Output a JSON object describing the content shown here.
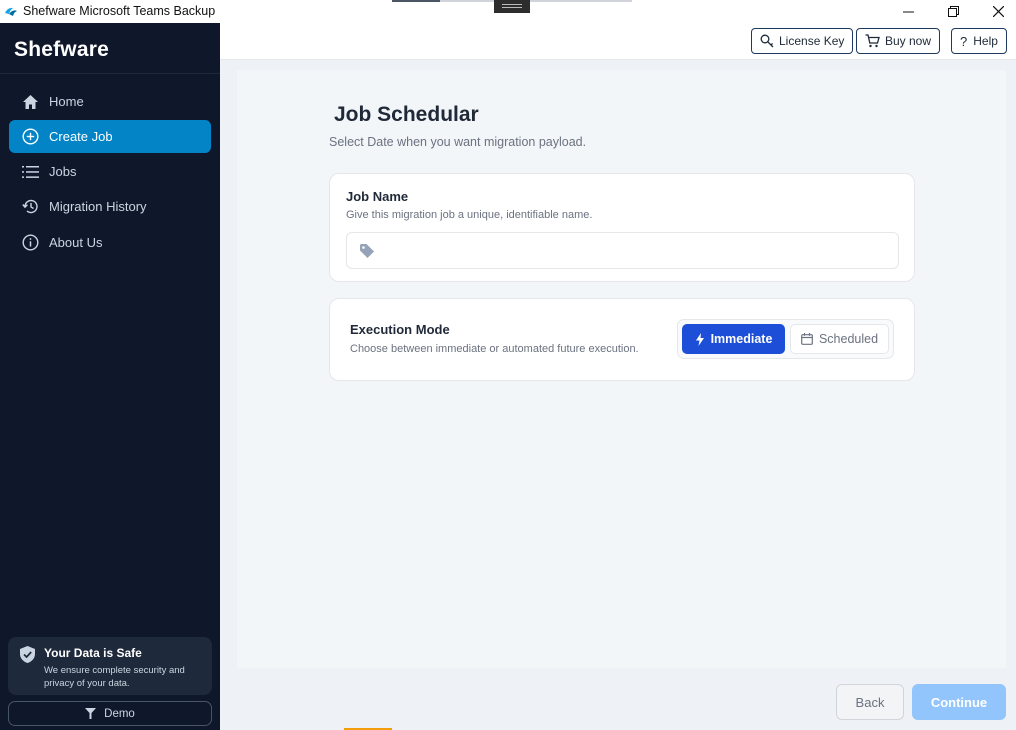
{
  "window": {
    "title": "Shefware Microsoft Teams Backup"
  },
  "sidebar": {
    "brand": "Shefware",
    "items": [
      {
        "label": "Home",
        "icon": "home-icon",
        "active": false
      },
      {
        "label": "Create Job",
        "icon": "plus-circle-icon",
        "active": true
      },
      {
        "label": "Jobs",
        "icon": "list-icon",
        "active": false
      },
      {
        "label": "Migration History",
        "icon": "history-icon",
        "active": false
      },
      {
        "label": "About Us",
        "icon": "info-icon",
        "active": false
      }
    ],
    "safe_card": {
      "title": "Your Data is Safe",
      "text": "We ensure complete security and privacy of your data."
    },
    "demo_label": "Demo"
  },
  "header": {
    "license_key": "License Key",
    "buy_now": "Buy now",
    "help": "Help"
  },
  "main": {
    "title": "Job Schedular",
    "subtitle": "Select Date when you want migration  payload.",
    "job_name": {
      "title": "Job Name",
      "description": "Give this migration job a unique, identifiable name.",
      "value": "",
      "placeholder": ""
    },
    "execution_mode": {
      "title": "Execution Mode",
      "description": "Choose between immediate or automated future execution.",
      "options": [
        "Immediate",
        "Scheduled"
      ],
      "selected": "Immediate"
    }
  },
  "footer": {
    "back": "Back",
    "continue": "Continue"
  },
  "colors": {
    "sidebar_bg": "#0f172a",
    "active_nav": "#0284c7",
    "primary": "#1d4ed8",
    "continue_disabled": "#93c5fd"
  }
}
